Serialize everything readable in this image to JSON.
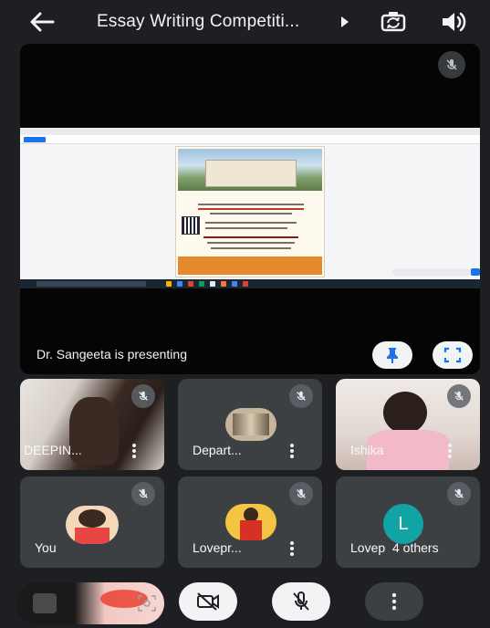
{
  "header": {
    "title": "Essay Writing Competiti...",
    "back_icon": "back-arrow-icon",
    "title_arrow_icon": "play-arrow-icon",
    "switch_camera_icon": "switch-camera-icon",
    "speaker_icon": "speaker-icon"
  },
  "presentation": {
    "presenter_label": "Dr. Sangeeta is presenting",
    "mute_icon": "mic-off-icon",
    "pin_icon": "pin-icon",
    "fullscreen_icon": "fullscreen-icon"
  },
  "participants": [
    {
      "name": "DEEPIN...",
      "muted": true
    },
    {
      "name": "Depart...",
      "muted": true
    },
    {
      "name": "Ishika",
      "muted": true
    },
    {
      "name": "You",
      "muted": true
    },
    {
      "name": "Lovepr...",
      "muted": true
    },
    {
      "name": "Lovep",
      "avatar_letter": "L",
      "others": "4 others",
      "muted": true
    }
  ],
  "controls": {
    "effects_icon": "effects-icon",
    "camera_icon": "camera-off-icon",
    "mic_icon": "mic-off-icon",
    "more_icon": "more-vertical-icon"
  },
  "colors": {
    "background": "#1e1f22",
    "tile": "#3c4043",
    "avatar_teal": "#12a4a4",
    "control_light": "#f1f3f4",
    "control_dark": "#3c4043"
  }
}
